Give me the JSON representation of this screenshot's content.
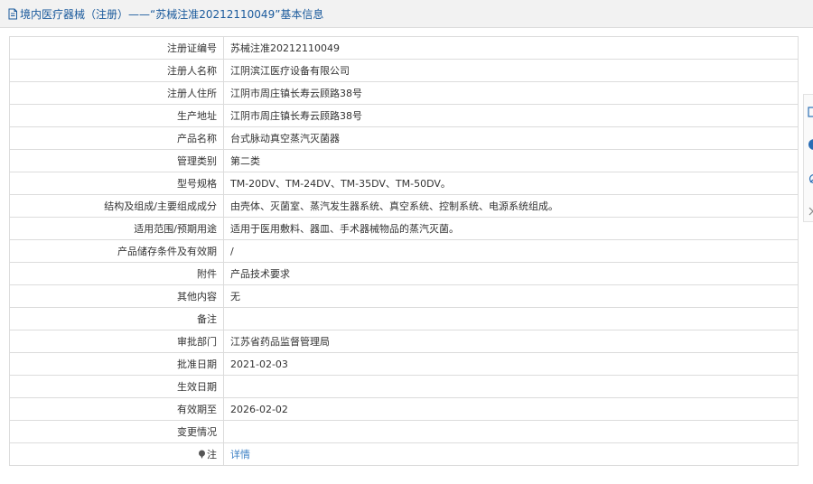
{
  "header": {
    "title": "境内医疗器械（注册）——“苏械注准20212110049”基本信息"
  },
  "rows": [
    {
      "label": "注册证编号",
      "value": "苏械注准20212110049"
    },
    {
      "label": "注册人名称",
      "value": "江阴滨江医疗设备有限公司"
    },
    {
      "label": "注册人住所",
      "value": "江阴市周庄镇长寿云顾路38号"
    },
    {
      "label": "生产地址",
      "value": "江阴市周庄镇长寿云顾路38号"
    },
    {
      "label": "产品名称",
      "value": "台式脉动真空蒸汽灭菌器"
    },
    {
      "label": "管理类别",
      "value": "第二类"
    },
    {
      "label": "型号规格",
      "value": "TM-20DV、TM-24DV、TM-35DV、TM-50DV。"
    },
    {
      "label": "结构及组成/主要组成成分",
      "value": "由壳体、灭菌室、蒸汽发生器系统、真空系统、控制系统、电源系统组成。"
    },
    {
      "label": "适用范围/预期用途",
      "value": "适用于医用敷料、器皿、手术器械物品的蒸汽灭菌。"
    },
    {
      "label": "产品储存条件及有效期",
      "value": "/"
    },
    {
      "label": "附件",
      "value": "产品技术要求"
    },
    {
      "label": "其他内容",
      "value": "无"
    },
    {
      "label": "备注",
      "value": ""
    },
    {
      "label": "审批部门",
      "value": "江苏省药品监督管理局"
    },
    {
      "label": "批准日期",
      "value": "2021-02-03"
    },
    {
      "label": "生效日期",
      "value": ""
    },
    {
      "label": "有效期至",
      "value": "2026-02-02"
    },
    {
      "label": "变更情况",
      "value": ""
    }
  ],
  "note_row": {
    "label": "注",
    "link": "详情"
  },
  "colors": {
    "header_text": "#1a5a9c",
    "link": "#3b7fc4",
    "border": "#dcdcdc",
    "toolbar_icon": "#2a6db5"
  },
  "toolbar_icons": [
    "window-icon",
    "info-icon",
    "copy-icon",
    "close-icon"
  ]
}
